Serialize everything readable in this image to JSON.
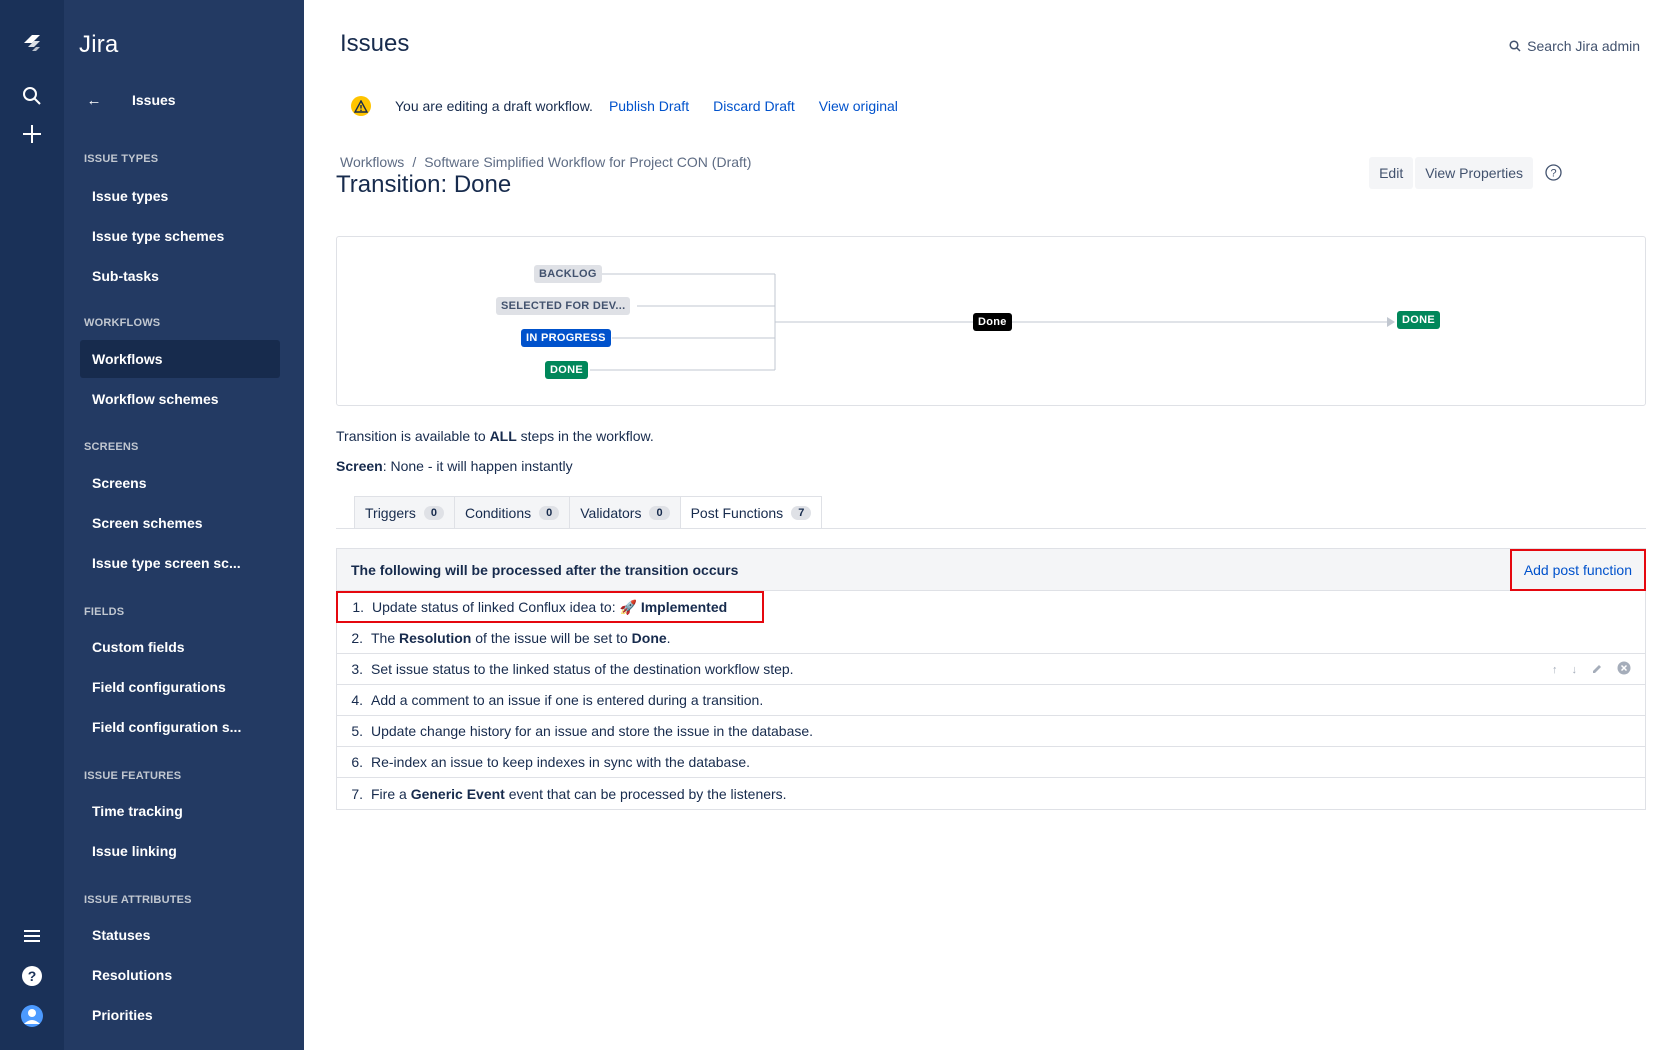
{
  "global_nav": {
    "icons": [
      "jira-logo-icon",
      "search-icon",
      "create-plus-icon",
      "menu-icon",
      "help-icon",
      "profile-icon"
    ]
  },
  "sidebar": {
    "app_title": "Jira",
    "back_label": "Issues",
    "sections": [
      {
        "title": "ISSUE TYPES",
        "items": [
          "Issue types",
          "Issue type schemes",
          "Sub-tasks"
        ]
      },
      {
        "title": "WORKFLOWS",
        "items": [
          "Workflows",
          "Workflow schemes"
        ]
      },
      {
        "title": "SCREENS",
        "items": [
          "Screens",
          "Screen schemes",
          "Issue type screen sc..."
        ]
      },
      {
        "title": "FIELDS",
        "items": [
          "Custom fields",
          "Field configurations",
          "Field configuration s..."
        ]
      },
      {
        "title": "ISSUE FEATURES",
        "items": [
          "Time tracking",
          "Issue linking"
        ]
      },
      {
        "title": "ISSUE ATTRIBUTES",
        "items": [
          "Statuses",
          "Resolutions",
          "Priorities"
        ]
      }
    ],
    "active_item": "Workflows"
  },
  "header": {
    "title": "Issues",
    "search_label": "Search Jira admin"
  },
  "notice": {
    "message": "You are editing a draft workflow.",
    "publish": "Publish Draft",
    "discard": "Discard Draft",
    "view_original": "View original"
  },
  "breadcrumb": {
    "root": "Workflows",
    "separator": "/",
    "current": "Software Simplified Workflow for Project CON (Draft)"
  },
  "transition": {
    "title": "Transition: Done",
    "edit": "Edit",
    "view_properties": "View Properties"
  },
  "diagram": {
    "from_statuses": [
      "BACKLOG",
      "SELECTED FOR DEV...",
      "IN PROGRESS",
      "DONE"
    ],
    "transition_label": "Done",
    "to_status": "DONE"
  },
  "availability": {
    "prefix": "Transition is available to ",
    "bold": "ALL",
    "suffix": " steps in the workflow."
  },
  "screen_info": {
    "label": "Screen",
    "value": ": None - it will happen instantly"
  },
  "tabs": [
    {
      "label": "Triggers",
      "count": "0"
    },
    {
      "label": "Conditions",
      "count": "0"
    },
    {
      "label": "Validators",
      "count": "0"
    },
    {
      "label": "Post Functions",
      "count": "7"
    }
  ],
  "post_functions": {
    "heading": "The following will be processed after the transition occurs",
    "add_label": "Add post function",
    "rows": [
      {
        "num": "1.",
        "parts": [
          [
            "Update status of linked Conflux idea to: 🚀 ",
            false
          ],
          [
            "Implemented",
            true
          ]
        ]
      },
      {
        "num": "2.",
        "parts": [
          [
            "The ",
            false
          ],
          [
            "Resolution",
            true
          ],
          [
            " of the issue will be set to ",
            false
          ],
          [
            "Done",
            true
          ],
          [
            ".",
            false
          ]
        ]
      },
      {
        "num": "3.",
        "parts": [
          [
            "Set issue status to the linked status of the destination workflow step.",
            false
          ]
        ]
      },
      {
        "num": "4.",
        "parts": [
          [
            "Add a comment to an issue if one is entered during a transition.",
            false
          ]
        ]
      },
      {
        "num": "5.",
        "parts": [
          [
            "Update change history for an issue and store the issue in the database.",
            false
          ]
        ]
      },
      {
        "num": "6.",
        "parts": [
          [
            "Re-index an issue to keep indexes in sync with the database.",
            false
          ]
        ]
      },
      {
        "num": "7.",
        "parts": [
          [
            "Fire a ",
            false
          ],
          [
            "Generic Event",
            true
          ],
          [
            " event that can be processed by the listeners.",
            false
          ]
        ]
      }
    ]
  },
  "colors": {
    "nav_dark": "#1a3158",
    "sidebar": "#233a63",
    "link": "#0052cc",
    "highlight_border": "#e5080f",
    "status_blue": "#0052cc",
    "status_green": "#00875a"
  }
}
